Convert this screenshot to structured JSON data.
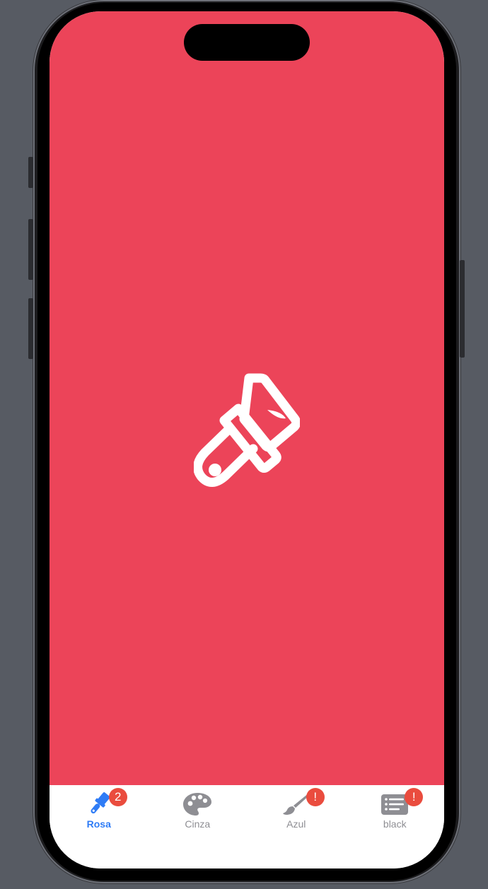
{
  "theme": {
    "background_color": "#EC4459",
    "tab_active_color": "#2F7CF6",
    "tab_inactive_color": "#8E8E93",
    "badge_color": "#EA4C3E"
  },
  "main": {
    "icon": "paintbrush-icon"
  },
  "tabs": [
    {
      "label": "Rosa",
      "icon": "paintbrush-icon",
      "badge": "2",
      "active": true
    },
    {
      "label": "Cinza",
      "icon": "palette-icon",
      "badge": "",
      "active": false
    },
    {
      "label": "Azul",
      "icon": "paintbrush-pointed-icon",
      "badge": "!",
      "active": false
    },
    {
      "label": "black",
      "icon": "list-bullet-rectangle-icon",
      "badge": "!",
      "active": false
    }
  ]
}
